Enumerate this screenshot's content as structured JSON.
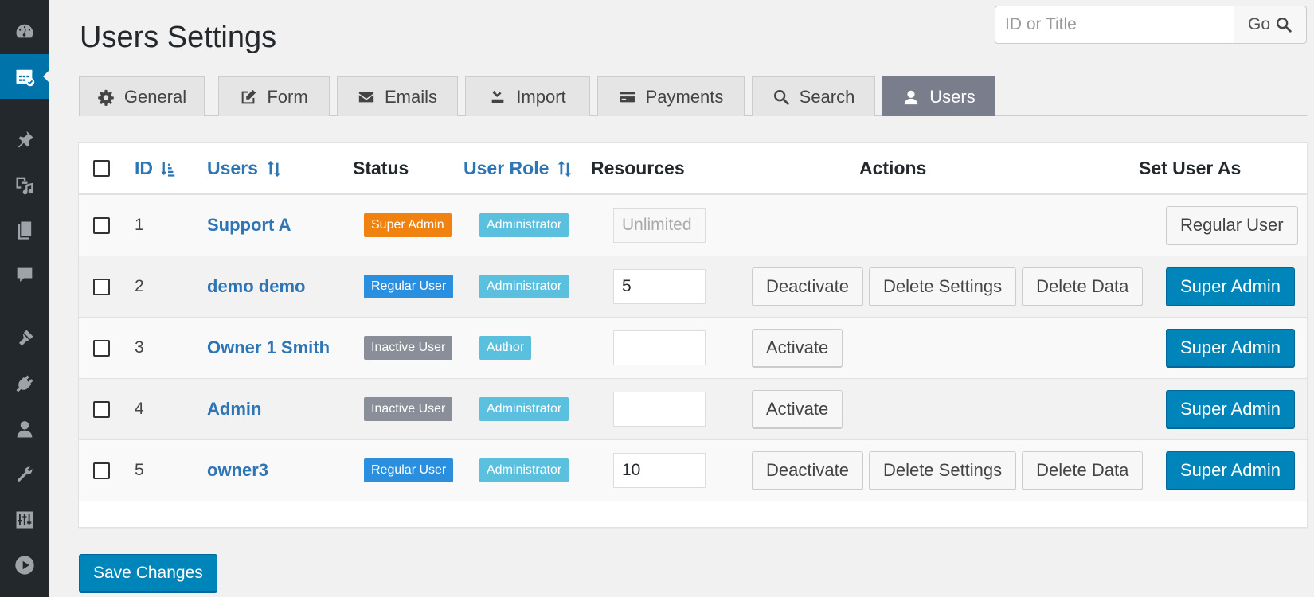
{
  "page": {
    "title": "Users Settings"
  },
  "search": {
    "placeholder": "ID or Title",
    "go_label": "Go"
  },
  "tabs": [
    {
      "label": "General",
      "icon": "gear-icon"
    },
    {
      "label": "Form",
      "icon": "edit-icon"
    },
    {
      "label": "Emails",
      "icon": "envelope-icon"
    },
    {
      "label": "Import",
      "icon": "import-icon"
    },
    {
      "label": "Payments",
      "icon": "credit-card-icon"
    },
    {
      "label": "Search",
      "icon": "search-icon"
    },
    {
      "label": "Users",
      "icon": "user-icon",
      "active": true
    }
  ],
  "table": {
    "headers": {
      "id": "ID",
      "users": "Users",
      "status": "Status",
      "user_role": "User Role",
      "resources": "Resources",
      "actions": "Actions",
      "set_user_as": "Set User As"
    },
    "rows": [
      {
        "id": "1",
        "user": "Support A",
        "status": "Super Admin",
        "status_color": "#f0820f",
        "role": "Administrator",
        "resources": "Unlimited",
        "resources_disabled": true,
        "actions": [],
        "set_as": "Regular User"
      },
      {
        "id": "2",
        "user": "demo demo",
        "status": "Regular User",
        "status_color": "#2b8fe0",
        "role": "Administrator",
        "resources": "5",
        "actions": [
          "Deactivate",
          "Delete Settings",
          "Delete Data"
        ],
        "set_as": "Super Admin"
      },
      {
        "id": "3",
        "user": "Owner 1 Smith",
        "status": "Inactive User",
        "status_color": "#8a8e99",
        "role": "Author",
        "resources": "",
        "actions": [
          "Activate"
        ],
        "set_as": "Super Admin"
      },
      {
        "id": "4",
        "user": "Admin",
        "status": "Inactive User",
        "status_color": "#8a8e99",
        "role": "Administrator",
        "resources": "",
        "actions": [
          "Activate"
        ],
        "set_as": "Super Admin"
      },
      {
        "id": "5",
        "user": "owner3",
        "status": "Regular User",
        "status_color": "#2b8fe0",
        "role": "Administrator",
        "resources": "10",
        "actions": [
          "Deactivate",
          "Delete Settings",
          "Delete Data"
        ],
        "set_as": "Super Admin"
      }
    ]
  },
  "footer": {
    "save_label": "Save Changes"
  },
  "sidebar": {
    "items": [
      {
        "icon": "dashboard-icon"
      },
      {
        "icon": "calendar-icon",
        "active": true
      },
      {
        "icon": "pin-icon"
      },
      {
        "icon": "media-icon"
      },
      {
        "icon": "pages-icon"
      },
      {
        "icon": "comments-icon"
      },
      {
        "icon": "appearance-icon"
      },
      {
        "icon": "plugins-icon"
      },
      {
        "icon": "users-icon"
      },
      {
        "icon": "tools-icon"
      },
      {
        "icon": "settings-icon"
      },
      {
        "icon": "play-icon"
      }
    ]
  },
  "colors": {
    "primary": "#0085ba",
    "link": "#2e75b6",
    "sidebar": "#23282d",
    "active_tab": "#7a7d8c"
  }
}
